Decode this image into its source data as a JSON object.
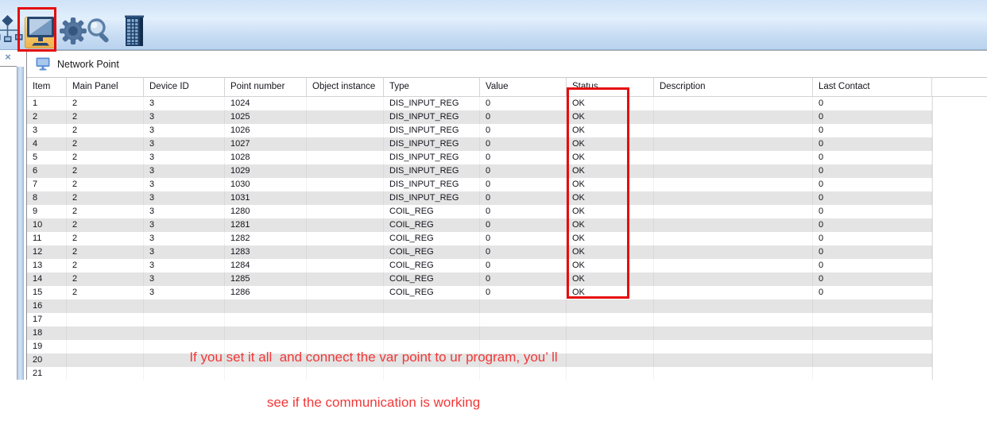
{
  "toolbar": {
    "buttons": [
      {
        "id": "network-tree",
        "selected": false
      },
      {
        "id": "network-point-monitor",
        "selected": true
      },
      {
        "id": "settings-gear",
        "selected": false
      },
      {
        "id": "search-magnifier",
        "selected": false
      },
      {
        "id": "building",
        "selected": false
      }
    ]
  },
  "sidebar": {
    "close_label": "×"
  },
  "panel": {
    "title": "Network Point"
  },
  "table": {
    "columns": [
      "Item",
      "Main Panel",
      "Device ID",
      "Point number",
      "Object instance",
      "Type",
      "Value",
      "Status",
      "Description",
      "Last Contact"
    ],
    "rows": [
      [
        "1",
        "2",
        "3",
        "1024",
        "",
        "DIS_INPUT_REG",
        "0",
        "OK",
        "",
        "0"
      ],
      [
        "2",
        "2",
        "3",
        "1025",
        "",
        "DIS_INPUT_REG",
        "0",
        "OK",
        "",
        "0"
      ],
      [
        "3",
        "2",
        "3",
        "1026",
        "",
        "DIS_INPUT_REG",
        "0",
        "OK",
        "",
        "0"
      ],
      [
        "4",
        "2",
        "3",
        "1027",
        "",
        "DIS_INPUT_REG",
        "0",
        "OK",
        "",
        "0"
      ],
      [
        "5",
        "2",
        "3",
        "1028",
        "",
        "DIS_INPUT_REG",
        "0",
        "OK",
        "",
        "0"
      ],
      [
        "6",
        "2",
        "3",
        "1029",
        "",
        "DIS_INPUT_REG",
        "0",
        "OK",
        "",
        "0"
      ],
      [
        "7",
        "2",
        "3",
        "1030",
        "",
        "DIS_INPUT_REG",
        "0",
        "OK",
        "",
        "0"
      ],
      [
        "8",
        "2",
        "3",
        "1031",
        "",
        "DIS_INPUT_REG",
        "0",
        "OK",
        "",
        "0"
      ],
      [
        "9",
        "2",
        "3",
        "1280",
        "",
        "COIL_REG",
        "0",
        "OK",
        "",
        "0"
      ],
      [
        "10",
        "2",
        "3",
        "1281",
        "",
        "COIL_REG",
        "0",
        "OK",
        "",
        "0"
      ],
      [
        "11",
        "2",
        "3",
        "1282",
        "",
        "COIL_REG",
        "0",
        "OK",
        "",
        "0"
      ],
      [
        "12",
        "2",
        "3",
        "1283",
        "",
        "COIL_REG",
        "0",
        "OK",
        "",
        "0"
      ],
      [
        "13",
        "2",
        "3",
        "1284",
        "",
        "COIL_REG",
        "0",
        "OK",
        "",
        "0"
      ],
      [
        "14",
        "2",
        "3",
        "1285",
        "",
        "COIL_REG",
        "0",
        "OK",
        "",
        "0"
      ],
      [
        "15",
        "2",
        "3",
        "1286",
        "",
        "COIL_REG",
        "0",
        "OK",
        "",
        "0"
      ],
      [
        "16",
        "",
        "",
        "",
        "",
        "",
        "",
        "",
        "",
        ""
      ],
      [
        "17",
        "",
        "",
        "",
        "",
        "",
        "",
        "",
        "",
        ""
      ],
      [
        "18",
        "",
        "",
        "",
        "",
        "",
        "",
        "",
        "",
        ""
      ],
      [
        "19",
        "",
        "",
        "",
        "",
        "",
        "",
        "",
        "",
        ""
      ],
      [
        "20",
        "",
        "",
        "",
        "",
        "",
        "",
        "",
        "",
        ""
      ],
      [
        "21",
        "",
        "",
        "",
        "",
        "",
        "",
        "",
        "",
        ""
      ]
    ]
  },
  "annotations": {
    "highlight_color": "#e60d0d",
    "note_color": "#f23838",
    "note": {
      "line1": "If you set it all  and connect the var point to ur program, you’ ll",
      "line2": "see if the communication is working"
    }
  }
}
